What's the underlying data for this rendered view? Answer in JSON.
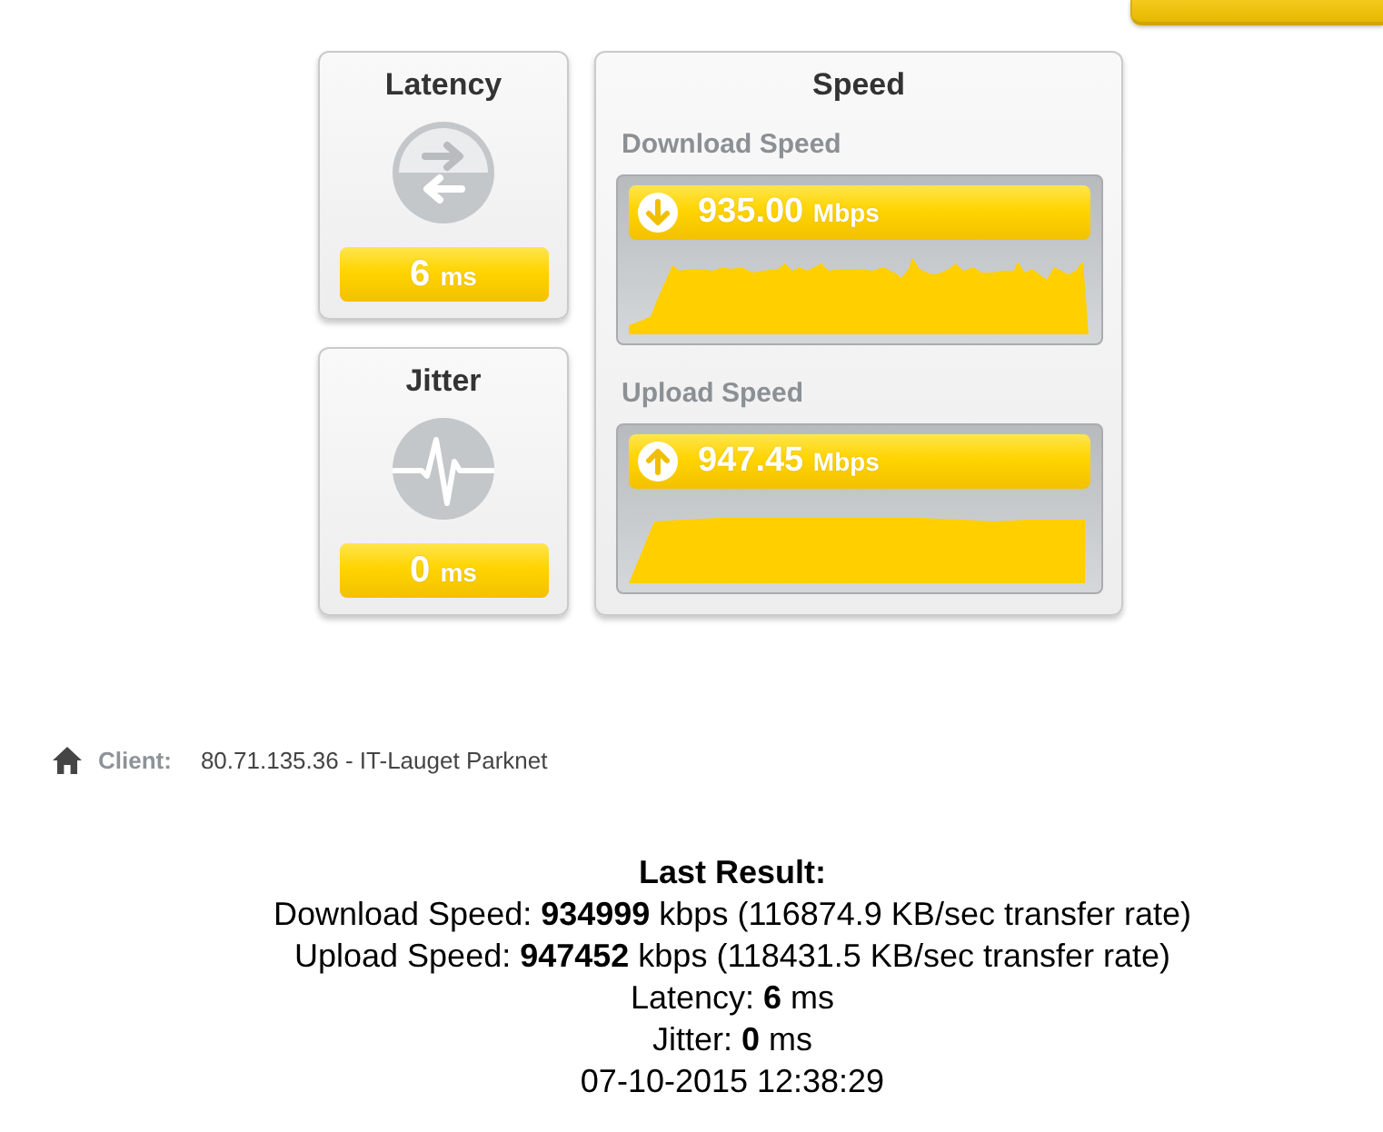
{
  "metrics": [
    {
      "kind": "latency",
      "title": "Latency",
      "value": "6",
      "unit": "ms"
    },
    {
      "kind": "jitter",
      "title": "Jitter",
      "value": "0",
      "unit": "ms"
    }
  ],
  "speed": {
    "title": "Speed",
    "tests": [
      {
        "kind": "download",
        "label": "Download Speed",
        "value": "935.00",
        "unit": "Mbps"
      },
      {
        "kind": "upload",
        "label": "Upload Speed",
        "value": "947.45",
        "unit": "Mbps"
      }
    ]
  },
  "client": {
    "label": "Client:",
    "value": "80.71.135.36 - IT-Lauget Parknet"
  },
  "last_result": {
    "title": "Last Result:",
    "lines": [
      "Download Speed: **934999** kbps (116874.9 KB/sec transfer rate)",
      "Upload Speed: **947452** kbps (118431.5 KB/sec transfer rate)",
      "Latency: **6** ms",
      "Jitter: **0** ms"
    ],
    "timestamp": "07-10-2015 12:38:29"
  }
}
